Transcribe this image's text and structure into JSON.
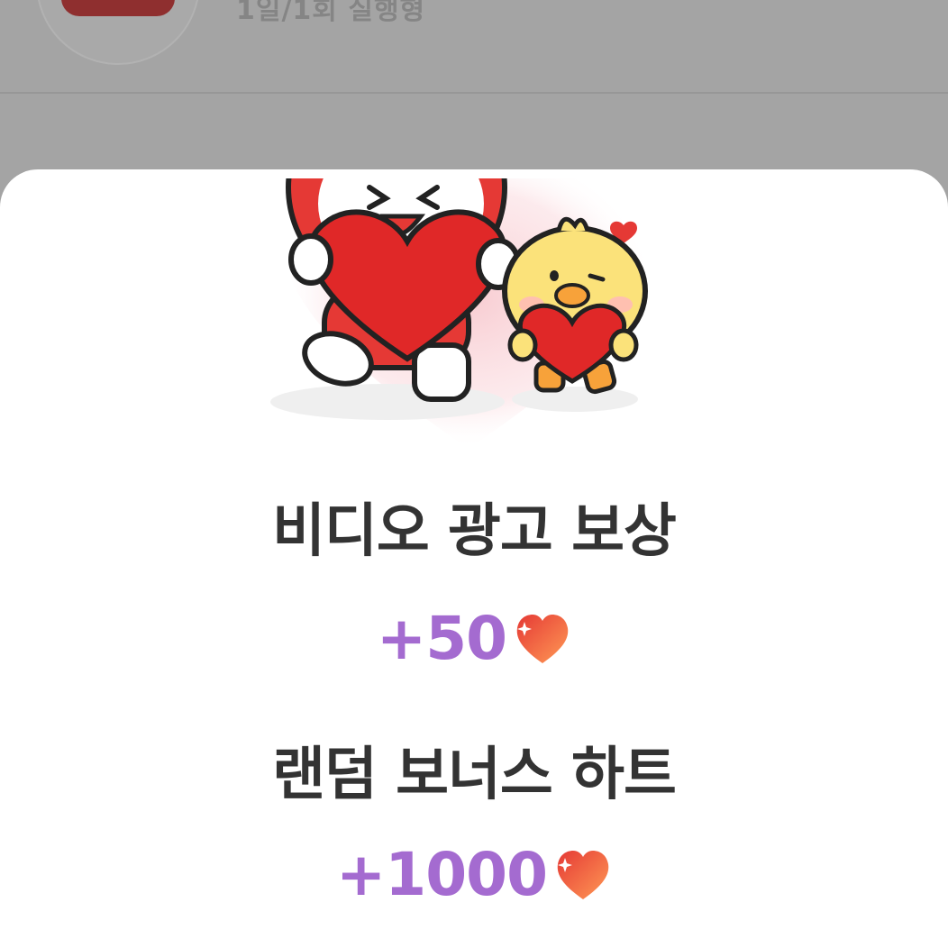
{
  "background": {
    "row_subtitle": "1일/1회 실행형"
  },
  "reward_sheet": {
    "illustration": "bunny-and-chick-holding-hearts",
    "video_ad_reward": {
      "label": "비디오 광고 보상",
      "amount": "+50",
      "icon": "heart-icon"
    },
    "random_bonus": {
      "label": "랜덤 보너스 하트",
      "amount": "+1000",
      "icon": "heart-icon"
    }
  },
  "colors": {
    "dim_overlay": "#a4a4a4",
    "sheet": "#ffffff",
    "title_text": "#333333",
    "amount_text": "#a46bd0",
    "heart_red": "#e53935",
    "heart_orange": "#ff8a50"
  }
}
